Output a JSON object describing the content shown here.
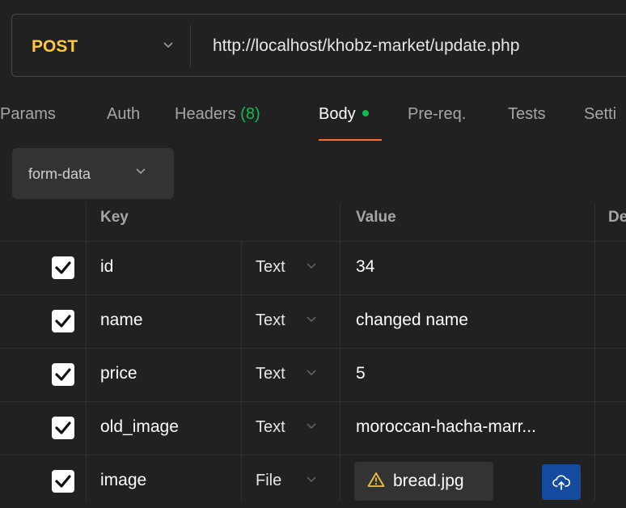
{
  "request": {
    "method": "POST",
    "url": "http://localhost/khobz-market/update.php"
  },
  "tabs": [
    {
      "label": "Params"
    },
    {
      "label": "Auth"
    },
    {
      "label": "Headers",
      "count": "(8)"
    },
    {
      "label": "Body",
      "active": true,
      "modified": true
    },
    {
      "label": "Pre-req."
    },
    {
      "label": "Tests"
    },
    {
      "label": "Setti"
    }
  ],
  "body_mode": "form-data",
  "table": {
    "headers": {
      "key": "Key",
      "value": "Value",
      "description": "De"
    },
    "rows": [
      {
        "checked": true,
        "key": "id",
        "type": "Text",
        "value": "34"
      },
      {
        "checked": true,
        "key": "name",
        "type": "Text",
        "value": "changed name"
      },
      {
        "checked": true,
        "key": "price",
        "type": "Text",
        "value": "5"
      },
      {
        "checked": true,
        "key": "old_image",
        "type": "Text",
        "value": "moroccan-hacha-marr..."
      },
      {
        "checked": true,
        "key": "image",
        "type": "File",
        "value": "bread.jpg",
        "value_icon": "warning-icon",
        "action_icon": "cloud-upload-icon"
      }
    ]
  },
  "colors": {
    "method": "#ffc83d",
    "active_tab_underline": "#ff6c37",
    "modified_dot": "#0cbb52",
    "upload_button": "#154b9e"
  }
}
